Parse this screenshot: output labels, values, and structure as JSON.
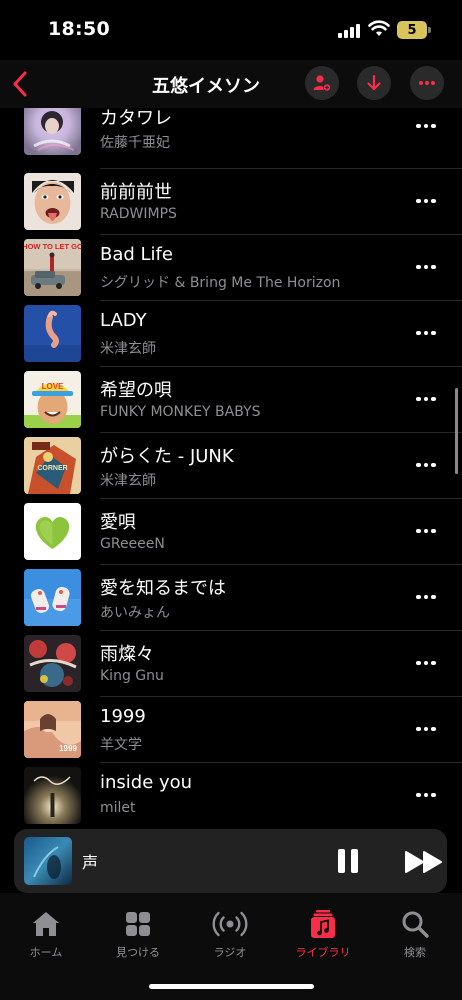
{
  "status_bar": {
    "time": "18:50",
    "battery_level": "5",
    "battery_color": "#d8c45a"
  },
  "nav": {
    "title": "五悠イメソン",
    "back_icon": "chevron-left-icon",
    "actions": [
      "person-add-icon",
      "download-icon",
      "more-icon"
    ],
    "accent_color": "#fa2d48"
  },
  "songs": [
    {
      "title": "カタワレ",
      "artist": "佐藤千亜妃"
    },
    {
      "title": "前前前世",
      "artist": "RADWIMPS"
    },
    {
      "title": "Bad Life",
      "artist": "シグリッド & Bring Me The Horizon"
    },
    {
      "title": "LADY",
      "artist": "米津玄師"
    },
    {
      "title": "希望の唄",
      "artist": "FUNKY MONKEY BABYS"
    },
    {
      "title": "がらくた - JUNK",
      "artist": "米津玄師"
    },
    {
      "title": "愛唄",
      "artist": "GReeeeN"
    },
    {
      "title": "愛を知るまでは",
      "artist": "あいみょん"
    },
    {
      "title": "雨燦々",
      "artist": "King Gnu"
    },
    {
      "title": "1999",
      "artist": "羊文学"
    },
    {
      "title": "inside you",
      "artist": "milet"
    }
  ],
  "artwork_texts": {
    "bad_life": "HOW TO LET GO",
    "kibou": "LOVE",
    "garakuta": "CORNER",
    "y1999": "1999"
  },
  "mini_player": {
    "title": "声"
  },
  "tabs": [
    {
      "label": "ホーム",
      "icon": "home-icon",
      "active": false
    },
    {
      "label": "見つける",
      "icon": "grid-icon",
      "active": false
    },
    {
      "label": "ラジオ",
      "icon": "radio-icon",
      "active": false
    },
    {
      "label": "ライブラリ",
      "icon": "library-icon",
      "active": true
    },
    {
      "label": "検索",
      "icon": "search-icon",
      "active": false
    }
  ]
}
